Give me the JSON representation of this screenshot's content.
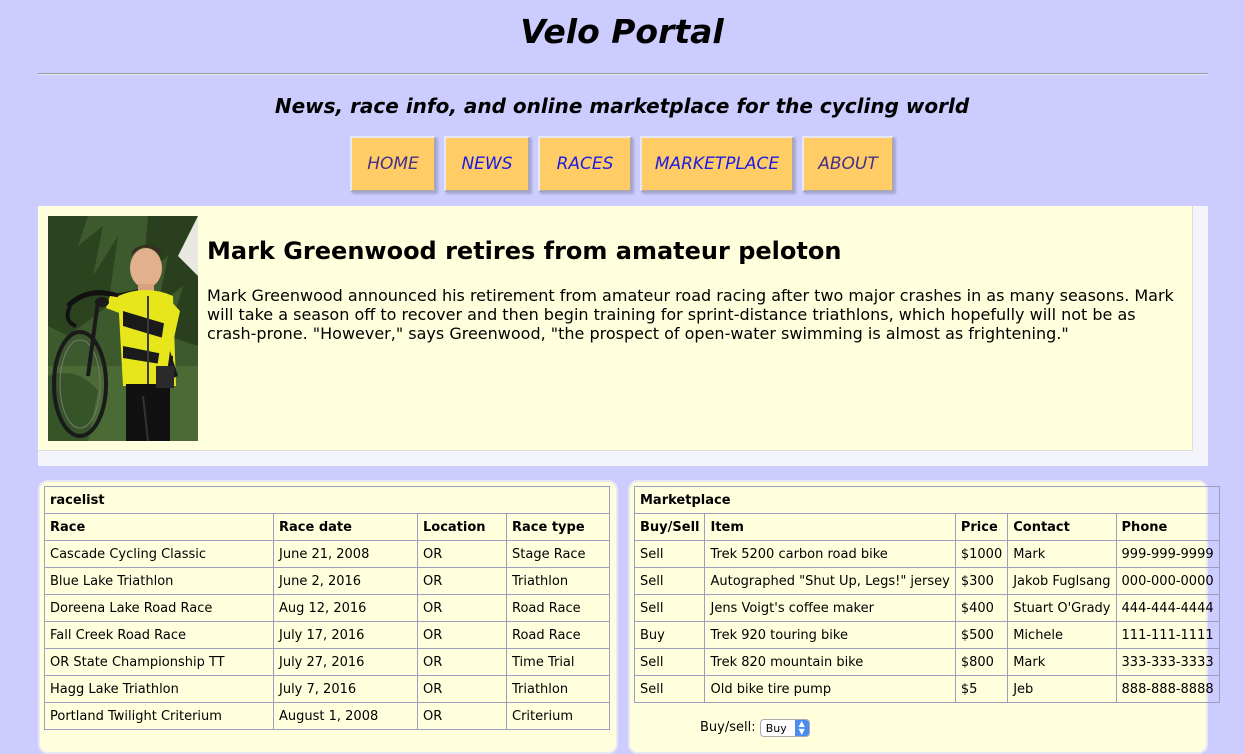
{
  "site": {
    "title": "Velo Portal",
    "tagline": "News, race info, and online marketplace for the cycling world"
  },
  "nav": {
    "items": [
      {
        "label": "HOME"
      },
      {
        "label": "NEWS"
      },
      {
        "label": "RACES"
      },
      {
        "label": "MARKETPLACE"
      },
      {
        "label": "ABOUT"
      }
    ]
  },
  "feature": {
    "headline": "Mark Greenwood retires from amateur peloton",
    "body": "Mark Greenwood announced his retirement from amateur road racing after two major crashes in as many seasons. Mark will take a season off to recover and then begin training for sprint-distance triathlons, which hopefully will not be as crash-prone. \"However,\" says Greenwood, \"the prospect of open-water swimming is almost as frightening.\""
  },
  "racelist": {
    "caption": "racelist",
    "headers": [
      "Race",
      "Race date",
      "Location",
      "Race type"
    ],
    "rows": [
      [
        "Cascade Cycling Classic",
        "June 21, 2008",
        "OR",
        "Stage Race"
      ],
      [
        "Blue Lake Triathlon",
        "June 2, 2016",
        "OR",
        "Triathlon"
      ],
      [
        "Doreena Lake Road Race",
        "Aug 12, 2016",
        "OR",
        "Road Race"
      ],
      [
        "Fall Creek Road Race",
        "July 17, 2016",
        "OR",
        "Road Race"
      ],
      [
        "OR State Championship TT",
        "July 27, 2016",
        "OR",
        "Time Trial"
      ],
      [
        "Hagg Lake Triathlon",
        "July 7, 2016",
        "OR",
        "Triathlon"
      ],
      [
        "Portland Twilight Criterium",
        "August 1, 2008",
        "OR",
        "Criterium"
      ]
    ]
  },
  "marketplace": {
    "caption": "Marketplace",
    "headers": [
      "Buy/Sell",
      "Item",
      "Price",
      "Contact",
      "Phone"
    ],
    "rows": [
      [
        "Sell",
        "Trek 5200 carbon road bike",
        "$1000",
        "Mark",
        "999-999-9999"
      ],
      [
        "Sell",
        "Autographed \"Shut Up, Legs!\" jersey",
        "$300",
        "Jakob Fuglsang",
        "000-000-0000"
      ],
      [
        "Sell",
        "Jens Voigt's coffee maker",
        "$400",
        "Stuart O'Grady",
        "444-444-4444"
      ],
      [
        "Buy",
        "Trek 920 touring bike",
        "$500",
        "Michele",
        "111-111-1111"
      ],
      [
        "Sell",
        "Trek 820 mountain bike",
        "$800",
        "Mark",
        "333-333-3333"
      ],
      [
        "Sell",
        "Old bike tire pump",
        "$5",
        "Jeb",
        "888-888-8888"
      ]
    ],
    "form": {
      "buysell_label": "Buy/sell:",
      "buysell_value": "Buy"
    }
  },
  "colors": {
    "page_background": "#ccccff",
    "content_background": "#ffffdd",
    "nav_button": "#ffcc66",
    "nav_link": "#1c1ce6",
    "nav_visited": "#46318c"
  },
  "icons": {
    "select_caret": "up-down-chevron-icon"
  }
}
